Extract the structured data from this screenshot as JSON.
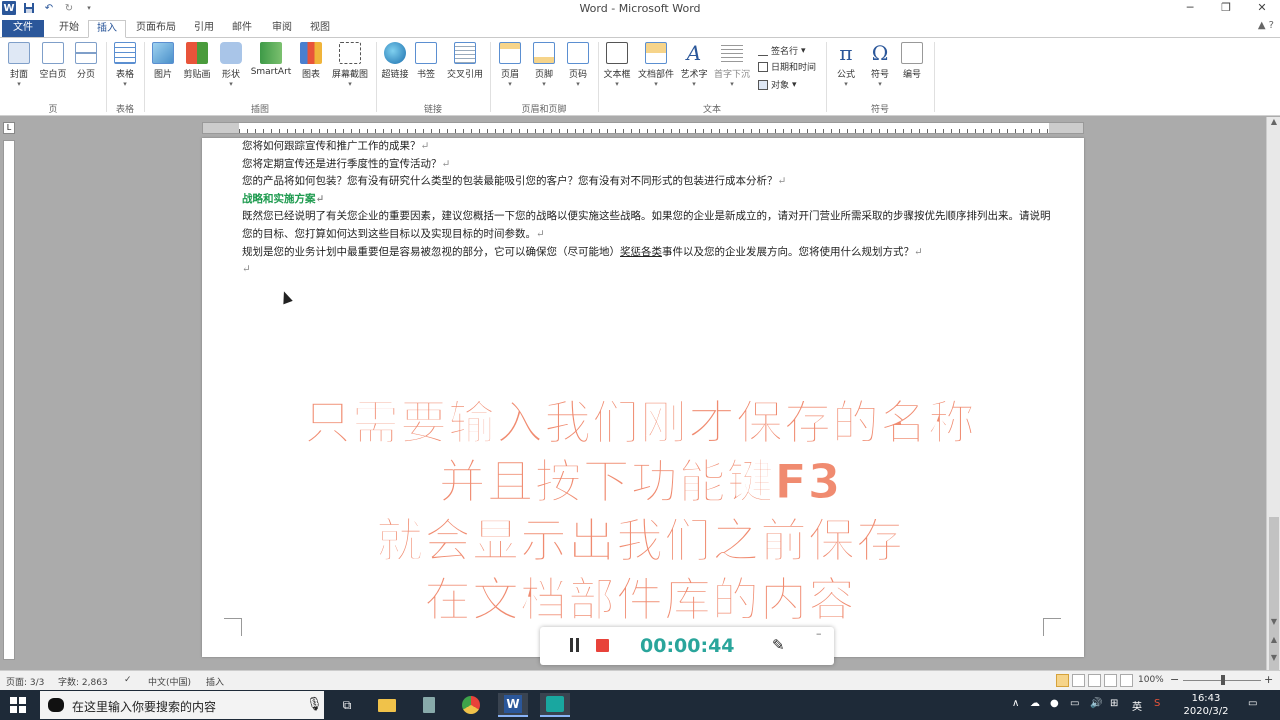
{
  "window": {
    "title": "Word - Microsoft Word",
    "minimize": "─",
    "restore": "❐",
    "close": "✕"
  },
  "qat": {
    "word": "W",
    "save": "💾",
    "undo": "↶",
    "redo": "↻"
  },
  "tabs": [
    "文件",
    "开始",
    "插入",
    "页面布局",
    "引用",
    "邮件",
    "审阅",
    "视图"
  ],
  "ribbon": {
    "groups": [
      "页",
      "表格",
      "插图",
      "链接",
      "页眉和页脚",
      "文本",
      "符号"
    ],
    "buttons": [
      "封面",
      "空白页",
      "分页",
      "表格",
      "图片",
      "剪贴画",
      "形状",
      "SmartArt",
      "图表",
      "屏幕截图",
      "超链接",
      "书签",
      "交叉引用",
      "页眉",
      "页脚",
      "页码",
      "文本框",
      "文档部件",
      "艺术字",
      "首字下沉",
      "公式",
      "符号",
      "编号"
    ],
    "small": [
      "签名行",
      "日期和时间",
      "对象"
    ]
  },
  "document": {
    "lines": [
      "您将如何跟踪宣传和推广工作的成果？",
      "您将定期宣传还是进行季度性的宣传活动？",
      "您的产品将如何包装？您有没有研究什么类型的包装最能吸引您的客户？您有没有对不同形式的包装进行成本分析？"
    ],
    "heading": "战略和实施方案",
    "para1": "既然您已经说明了有关您企业的重要因素，建议您概括一下您的战略以便实施这些战略。如果您的企业是新成立的，请对开门营业所需采取的步骤按优先顺序排列出来。请说明您的目标、您打算如何达到这些目标以及实现目标的时间参数。",
    "para2_a": "规划是您的业务计划中最重要但是容易被忽视的部分，它可以确保您（尽可能地）",
    "para2_u": "奖惩各类",
    "para2_b": "事件以及您的企业发展方向。您将使用什么规划方式？"
  },
  "caption": {
    "line1": "只需要输入我们刚才保存的名称",
    "line2": "并且按下功能键F3",
    "line3": "就会显示出我们之前保存",
    "line4": "在文档部件库的内容"
  },
  "recorder": {
    "time": "00:00:44",
    "minimize": "–",
    "pen": "✎"
  },
  "status": {
    "page": "页面: 3/3",
    "words": "字数: 2,863",
    "lang": "中文(中国)",
    "mode": "插入",
    "zoom": "100%",
    "minus": "−",
    "plus": "+"
  },
  "taskbar": {
    "search_placeholder": "在这里输入你要搜索的内容",
    "time": "16:43",
    "date": "2020/3/2",
    "ime": "英",
    "tray_up": "∧"
  },
  "colors": {
    "accent": "#2b579a",
    "heading_green": "#1e9b4f",
    "caption": "#f08b70",
    "timer": "#2aa59b",
    "stop": "#e8423a"
  }
}
